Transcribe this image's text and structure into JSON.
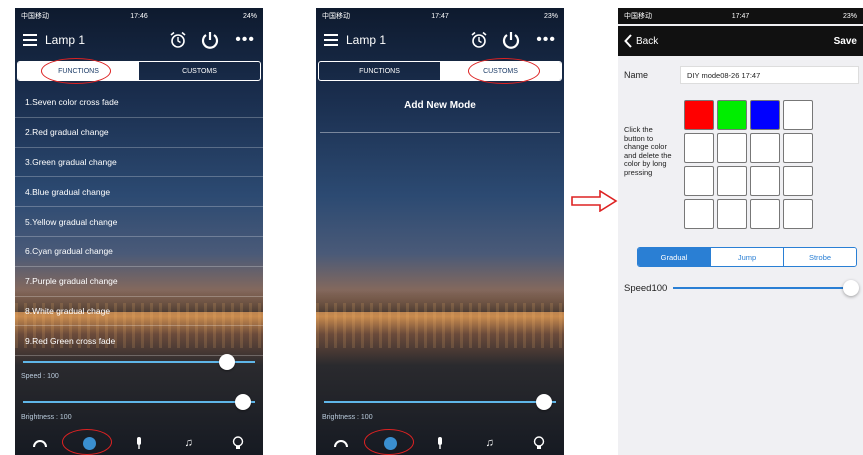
{
  "screen1": {
    "status": {
      "carrier": "中国移动",
      "time": "17:46",
      "battery": "24%"
    },
    "title": "Lamp 1",
    "more_label": "•••",
    "tabs": [
      {
        "label": "FUNCTIONS",
        "active": true
      },
      {
        "label": "CUSTOMS",
        "active": false
      }
    ],
    "functions": [
      "1.Seven color cross fade",
      "2.Red gradual change",
      "3.Green gradual change",
      "4.Blue gradual change",
      "5.Yellow gradual change",
      "6.Cyan gradual change",
      "7.Purple gradual change",
      "8.White gradual chage",
      "9.Red Green cross fade"
    ],
    "speed": {
      "label": "Speed : 100",
      "value": 100,
      "max": 100
    },
    "brightness": {
      "label": "Brightness : 100",
      "value": 100,
      "max": 100
    },
    "tabbar_icons": [
      "gauge-icon",
      "color-dot-icon",
      "mic-icon",
      "music-icon",
      "bulb-icon"
    ]
  },
  "screen2": {
    "status": {
      "carrier": "中国移动",
      "time": "17:47",
      "battery": "23%"
    },
    "title": "Lamp 1",
    "more_label": "•••",
    "tabs": [
      {
        "label": "FUNCTIONS",
        "active": false
      },
      {
        "label": "CUSTOMS",
        "active": true
      }
    ],
    "add_mode_label": "Add New Mode",
    "brightness": {
      "label": "Brightness : 100",
      "value": 100,
      "max": 100
    }
  },
  "screen3": {
    "status": {
      "carrier": "中国移动",
      "time": "17:47",
      "battery": "23%"
    },
    "back_label": "Back",
    "save_label": "Save",
    "name_label": "Name",
    "name_value": "DIY mode08-26 17:47",
    "hint": "Click the button to change color and delete the color by long pressing",
    "swatches": [
      "#ff0000",
      "#00ee00",
      "#0000ff",
      "#ffffff"
    ],
    "empty_cells": 12,
    "modes": [
      {
        "label": "Gradual",
        "active": true
      },
      {
        "label": "Jump",
        "active": false
      },
      {
        "label": "Strobe",
        "active": false
      }
    ],
    "speed_label": "Speed100",
    "speed_value": 100,
    "speed_max": 100
  },
  "colors": {
    "accent": "#2a7fd4",
    "highlight_ring": "#dd2222",
    "arrow": "#dd2222"
  }
}
